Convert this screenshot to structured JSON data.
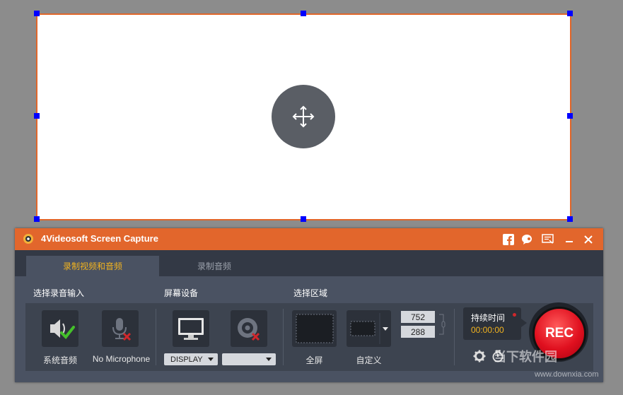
{
  "app": {
    "title": "4Videosoft Screen Capture",
    "accent_color": "#e2662c",
    "titlebar_icons": [
      "facebook-icon",
      "chat-icon",
      "register-icon",
      "minimize-icon",
      "close-icon"
    ]
  },
  "tabs": [
    {
      "label": "录制视频和音频",
      "active": true
    },
    {
      "label": "录制音频",
      "active": false
    }
  ],
  "sections": {
    "audio_input": "选择录音输入",
    "screen_device": "屏幕设备",
    "select_area": "选择区域"
  },
  "audio": {
    "system_audio_label": "系统音频",
    "microphone_label": "No Microphone"
  },
  "device": {
    "display_value": "DISPLAY",
    "webcam_value": ""
  },
  "area": {
    "fullscreen_label": "全屏",
    "custom_label": "自定义",
    "width": "752",
    "height": "288"
  },
  "recording": {
    "duration_label": "持续时间",
    "duration_value": "00:00:00",
    "rec_label": "REC",
    "rec_color": "#e0101f"
  },
  "watermark": {
    "text": "当下软件园",
    "url": "www.downxia.com"
  }
}
